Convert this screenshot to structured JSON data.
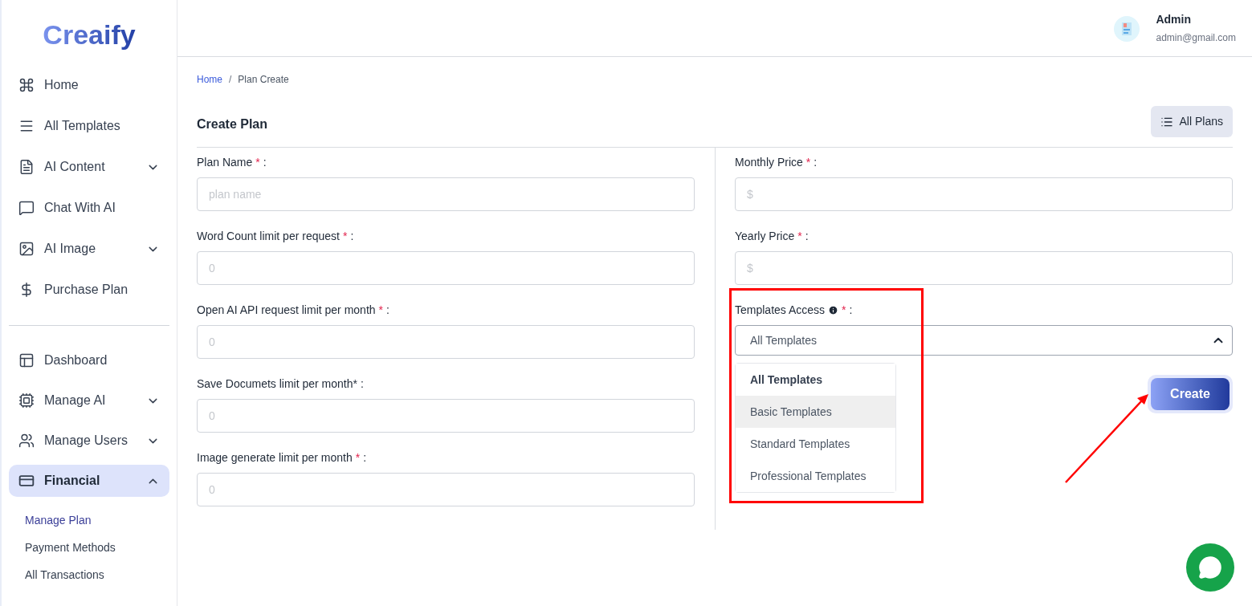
{
  "brand": "Creaify",
  "sidebar": {
    "items": [
      {
        "label": "Home",
        "kind": "link",
        "selected": false
      },
      {
        "label": "All Templates",
        "kind": "link",
        "selected": false
      },
      {
        "label": "AI Content",
        "kind": "group",
        "expanded": false,
        "selected": false
      },
      {
        "label": "Chat With AI",
        "kind": "link",
        "selected": false
      },
      {
        "label": "AI Image",
        "kind": "group",
        "expanded": false,
        "selected": false
      },
      {
        "label": "Purchase Plan",
        "kind": "link",
        "selected": false
      }
    ],
    "admin_items": [
      {
        "label": "Dashboard",
        "kind": "link",
        "selected": false
      },
      {
        "label": "Manage AI",
        "kind": "group",
        "expanded": false,
        "selected": false
      },
      {
        "label": "Manage Users",
        "kind": "group",
        "expanded": false,
        "selected": false
      },
      {
        "label": "Financial",
        "kind": "group",
        "expanded": true,
        "selected": true,
        "children": [
          {
            "label": "Manage Plan",
            "selected": true
          },
          {
            "label": "Payment Methods",
            "selected": false
          },
          {
            "label": "All Transactions",
            "selected": false
          }
        ]
      }
    ]
  },
  "user": {
    "name": "Admin",
    "email": "admin@gmail.com"
  },
  "breadcrumb": [
    {
      "label": "Home",
      "kind": "link"
    },
    {
      "label": "/",
      "kind": "separator"
    },
    {
      "label": "Plan Create",
      "kind": "text"
    }
  ],
  "card": {
    "title": "Create Plan",
    "button": "All Plans"
  },
  "left_fields": [
    {
      "label": "Plan Name",
      "mark": "*",
      "suffix": ":",
      "placeholder": "plan name"
    },
    {
      "label": "Word Count limit per request",
      "mark": "*",
      "suffix": ":",
      "placeholder": "0"
    },
    {
      "label": "Open AI API request limit per month",
      "mark": "*",
      "suffix": ":",
      "placeholder": "0"
    },
    {
      "label": "Save Documets limit per month*",
      "suffix": ":",
      "placeholder": "0"
    },
    {
      "label": "Image generate limit per month",
      "mark": "*",
      "suffix": ":",
      "placeholder": "0"
    }
  ],
  "right_fields": [
    {
      "label": "Monthly Price",
      "mark": "*",
      "suffix": ":",
      "placeholder": "$"
    },
    {
      "label": "Yearly Price",
      "mark": "*",
      "suffix": ":",
      "placeholder": "$"
    }
  ],
  "templates_access": {
    "label": "Templates Access",
    "mark": "*",
    "suffix": ":",
    "value": "All Templates",
    "expanded": true,
    "options": [
      {
        "label": "All Templates",
        "selected": true,
        "highlighted": false
      },
      {
        "label": "Basic Templates",
        "selected": false,
        "highlighted": true
      },
      {
        "label": "Standard Templates",
        "selected": false,
        "highlighted": false
      },
      {
        "label": "Professional Templates",
        "selected": false,
        "highlighted": false
      }
    ]
  },
  "submit": "Create"
}
